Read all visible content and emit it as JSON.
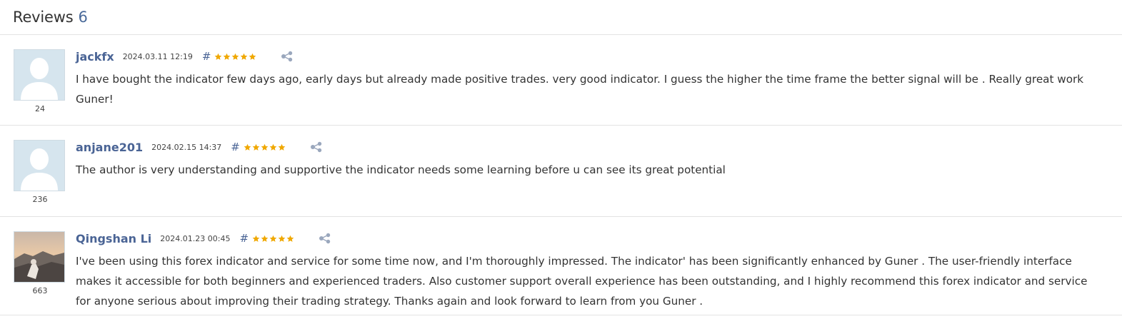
{
  "header": {
    "title": "Reviews",
    "count": "6"
  },
  "reviews": [
    {
      "author": "jackfx",
      "date": "2024.03.11 12:19",
      "hash": "#",
      "stars": 5,
      "user_rating": "24",
      "avatar": "default-avatar",
      "text": "I have bought the indicator few days ago, early days but already made positive trades. very good indicator. I guess the higher the time frame the better signal will be . Really great work Guner!"
    },
    {
      "author": "anjane201",
      "date": "2024.02.15 14:37",
      "hash": "#",
      "stars": 5,
      "user_rating": "236",
      "avatar": "default-avatar",
      "text": "The author is very understanding and supportive the indicator needs some learning before u can see its great potential"
    },
    {
      "author": "Qingshan Li",
      "date": "2024.01.23 00:45",
      "hash": "#",
      "stars": 5,
      "user_rating": "663",
      "avatar": "photo-avatar",
      "text": "I've been using this forex indicator and service for some time now, and I'm thoroughly impressed. The indicator' has been significantly enhanced by Guner . The user-friendly interface makes it accessible for both beginners and experienced traders. Also customer support overall experience has been outstanding, and I highly recommend this forex indicator and service for anyone serious about improving their trading strategy. Thanks again and look forward to learn from you Guner ."
    }
  ],
  "colors": {
    "author": "#4a6495",
    "star": "#f0a800",
    "divider": "#e3e3e3",
    "avatar_bg": "#d6e5ee"
  }
}
